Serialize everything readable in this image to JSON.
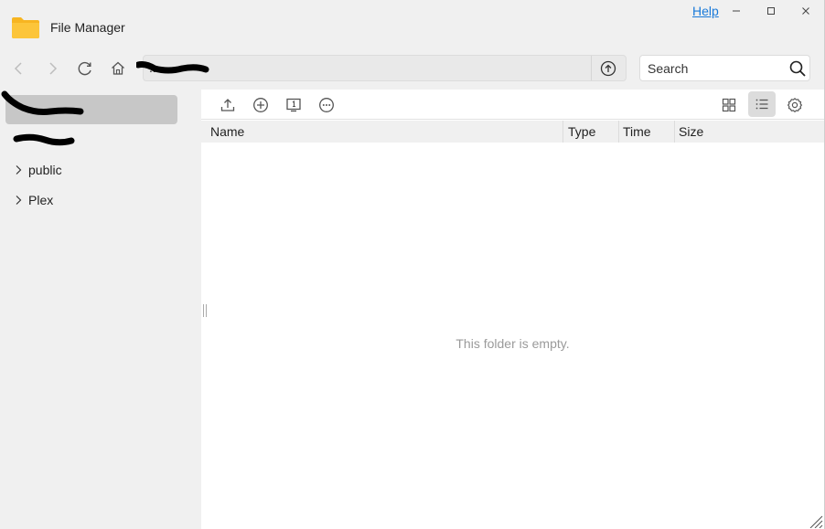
{
  "titlebar": {
    "app_title": "File Manager",
    "help_label": "Help",
    "folder_icon": "folder-icon",
    "minimize_icon": "minimize-icon",
    "maximize_icon": "maximize-icon",
    "close_icon": "close-icon",
    "folder_color": "#f7b521"
  },
  "navbar": {
    "path_text": "...",
    "search_placeholder": "Search"
  },
  "sidebar": {
    "items": [
      {
        "label": "",
        "selected": true,
        "redacted": true
      },
      {
        "label": "",
        "selected": false,
        "redacted": true
      },
      {
        "label": "public",
        "selected": false,
        "has_chevron": true
      },
      {
        "label": "Plex",
        "selected": false,
        "has_chevron": true
      }
    ]
  },
  "columns": {
    "name": "Name",
    "type": "Type",
    "time": "Time",
    "size": "Size"
  },
  "empty_message": "This folder is empty.",
  "colors": {
    "help_link": "#1a7ad9",
    "selected_item": "#c7c7c7",
    "toolbar_active": "#dcdcdc",
    "redaction": "#000000"
  }
}
